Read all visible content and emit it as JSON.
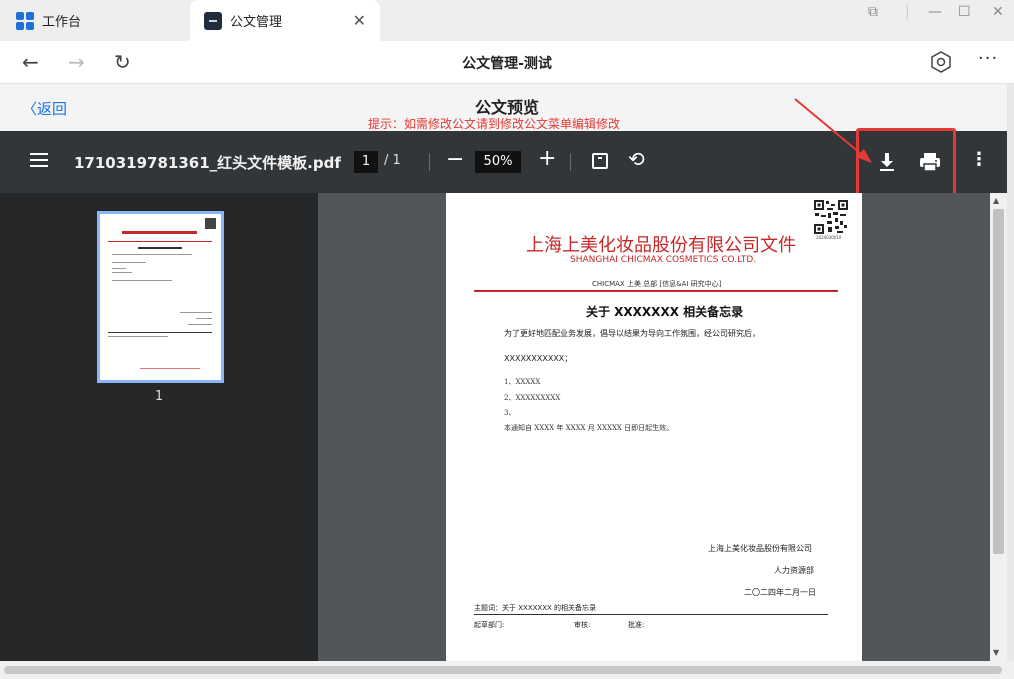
{
  "tabs": [
    {
      "label": "工作台",
      "icon": "grid-icon"
    },
    {
      "label": "公文管理",
      "icon": "doc-app-icon"
    }
  ],
  "nav": {
    "title": "公文管理-测试"
  },
  "subheader": {
    "back_label": "返回",
    "title": "公文预览",
    "hint": "提示：如需修改公文请到修改公文菜单编辑修改"
  },
  "pdf_toolbar": {
    "file_name": "1710319781361_红头文件模板.pdf",
    "current_page": "1",
    "total_pages": "/ 1",
    "zoom": "50%"
  },
  "sidebar": {
    "thumbnail_label": "1"
  },
  "document": {
    "org_name": "上海上美化妆品股份有限公司文件",
    "org_name_en": "SHANGHAI CHICMAX COSMETICS CO.LTD.",
    "dept_line": "CHICMAX 上美 总部 [信息&AI 研究中心]",
    "subject": "关于 XXXXXXX 相关备忘录",
    "para1": "为了更好地匹配业务发展，倡导以结果为导向工作氛围，经公司研究后，",
    "para2": "XXXXXXXXXXX；",
    "items": [
      "1、XXXXX",
      "2、XXXXXXXXX",
      "3、",
      "本通知自 XXXX 年 XXXX 月 XXXXX 日即日起生效。"
    ],
    "sig_company": "上海上美化妆品股份有限公司",
    "sig_dept": "人力资源部",
    "sig_date": "二〇二四年二月一日",
    "topic_line": "主题词：关于 XXXXXXX 的相关备忘录",
    "footer": {
      "drafter": "起草部门:",
      "reviewer": "审核:",
      "approver": "批准:"
    },
    "qr_code_text": "2024030010"
  },
  "colors": {
    "accent": "#1a73e8",
    "doc_red": "#c62828",
    "highlight": "#e53935",
    "toolbar": "#323639"
  }
}
